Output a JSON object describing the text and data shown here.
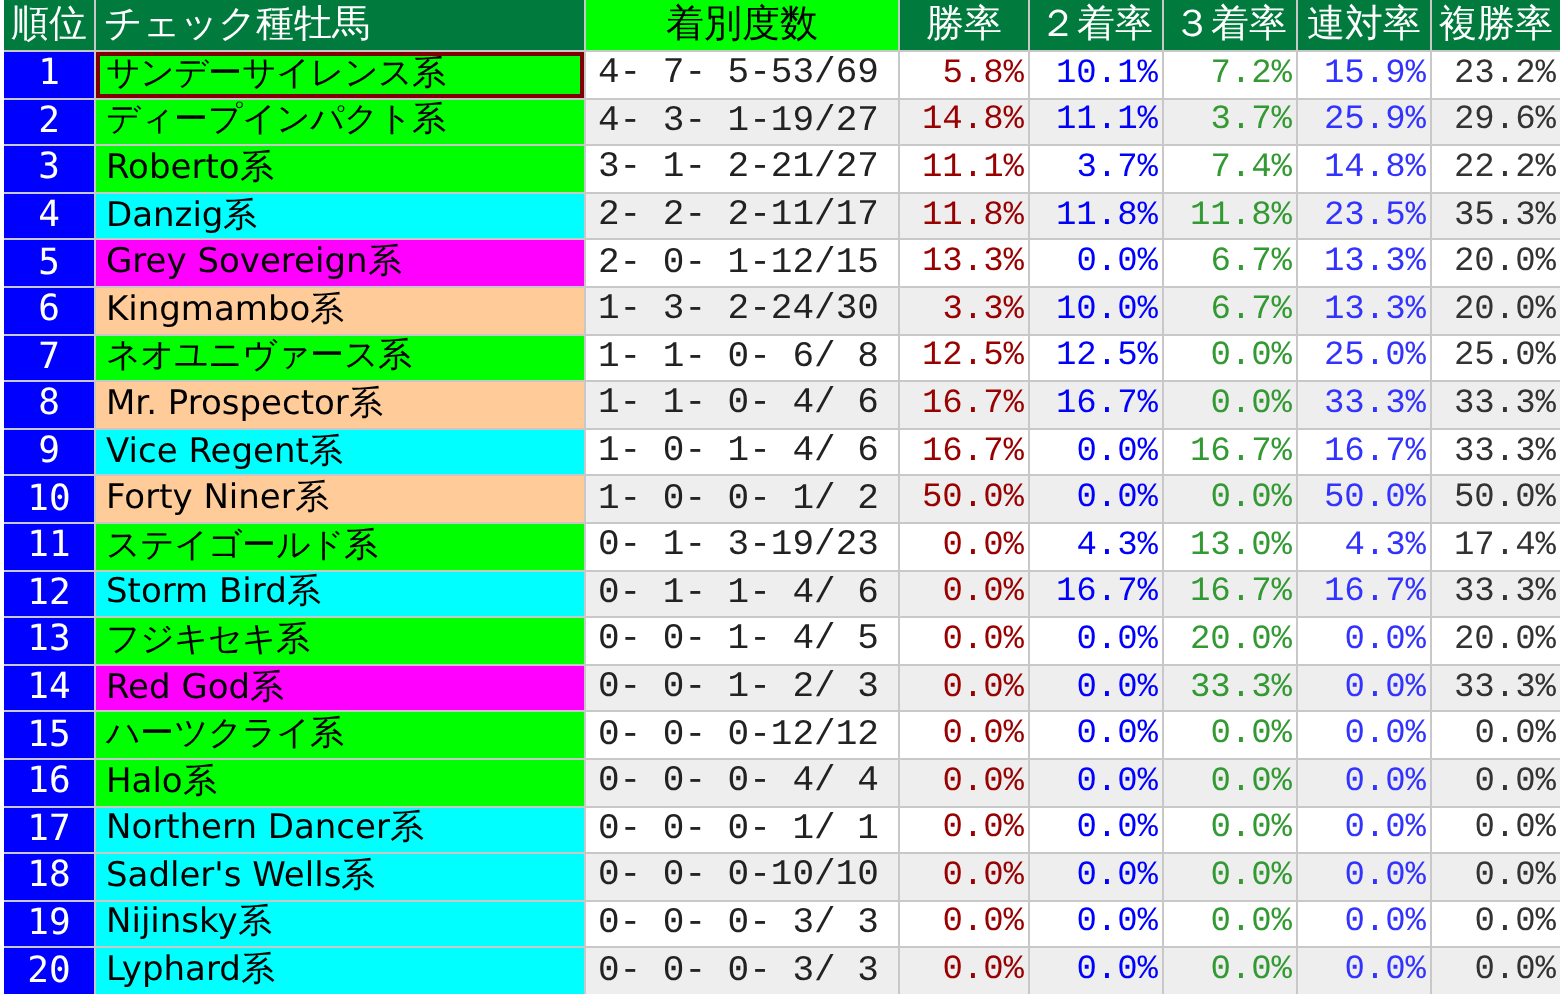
{
  "columns": [
    {
      "label": "順位",
      "highlighted": false
    },
    {
      "label": "チェック種牡馬",
      "highlighted": false
    },
    {
      "label": "着別度数",
      "highlighted": true
    },
    {
      "label": "勝率",
      "highlighted": false
    },
    {
      "label": "２着率",
      "highlighted": false
    },
    {
      "label": "３着率",
      "highlighted": false
    },
    {
      "label": "連対率",
      "highlighted": false
    },
    {
      "label": "複勝率",
      "highlighted": false
    }
  ],
  "rows": [
    {
      "rank": "1",
      "sire": "サンデーサイレンス系",
      "color": "#00ff00",
      "selected": true,
      "record": "4- 7- 5-53/69",
      "rates": [
        "5.8%",
        "10.1%",
        "7.2%",
        "15.9%",
        "23.2%"
      ]
    },
    {
      "rank": "2",
      "sire": "ディープインパクト系",
      "color": "#00ff00",
      "selected": false,
      "record": "4- 3- 1-19/27",
      "rates": [
        "14.8%",
        "11.1%",
        "3.7%",
        "25.9%",
        "29.6%"
      ]
    },
    {
      "rank": "3",
      "sire": "Roberto系",
      "color": "#00ff00",
      "selected": false,
      "record": "3- 1- 2-21/27",
      "rates": [
        "11.1%",
        "3.7%",
        "7.4%",
        "14.8%",
        "22.2%"
      ]
    },
    {
      "rank": "4",
      "sire": "Danzig系",
      "color": "#00ffff",
      "selected": false,
      "record": "2- 2- 2-11/17",
      "rates": [
        "11.8%",
        "11.8%",
        "11.8%",
        "23.5%",
        "35.3%"
      ]
    },
    {
      "rank": "5",
      "sire": "Grey Sovereign系",
      "color": "#ff00ff",
      "selected": false,
      "record": "2- 0- 1-12/15",
      "rates": [
        "13.3%",
        "0.0%",
        "6.7%",
        "13.3%",
        "20.0%"
      ]
    },
    {
      "rank": "6",
      "sire": "Kingmambo系",
      "color": "#ffcc99",
      "selected": false,
      "record": "1- 3- 2-24/30",
      "rates": [
        "3.3%",
        "10.0%",
        "6.7%",
        "13.3%",
        "20.0%"
      ]
    },
    {
      "rank": "7",
      "sire": "ネオユニヴァース系",
      "color": "#00ff00",
      "selected": false,
      "record": "1- 1- 0- 6/ 8",
      "rates": [
        "12.5%",
        "12.5%",
        "0.0%",
        "25.0%",
        "25.0%"
      ]
    },
    {
      "rank": "8",
      "sire": "Mr. Prospector系",
      "color": "#ffcc99",
      "selected": false,
      "record": "1- 1- 0- 4/ 6",
      "rates": [
        "16.7%",
        "16.7%",
        "0.0%",
        "33.3%",
        "33.3%"
      ]
    },
    {
      "rank": "9",
      "sire": "Vice Regent系",
      "color": "#00ffff",
      "selected": false,
      "record": "1- 0- 1- 4/ 6",
      "rates": [
        "16.7%",
        "0.0%",
        "16.7%",
        "16.7%",
        "33.3%"
      ]
    },
    {
      "rank": "10",
      "sire": "Forty Niner系",
      "color": "#ffcc99",
      "selected": false,
      "record": "1- 0- 0- 1/ 2",
      "rates": [
        "50.0%",
        "0.0%",
        "0.0%",
        "50.0%",
        "50.0%"
      ]
    },
    {
      "rank": "11",
      "sire": "ステイゴールド系",
      "color": "#00ff00",
      "selected": false,
      "record": "0- 1- 3-19/23",
      "rates": [
        "0.0%",
        "4.3%",
        "13.0%",
        "4.3%",
        "17.4%"
      ]
    },
    {
      "rank": "12",
      "sire": "Storm Bird系",
      "color": "#00ffff",
      "selected": false,
      "record": "0- 1- 1- 4/ 6",
      "rates": [
        "0.0%",
        "16.7%",
        "16.7%",
        "16.7%",
        "33.3%"
      ]
    },
    {
      "rank": "13",
      "sire": "フジキセキ系",
      "color": "#00ff00",
      "selected": false,
      "record": "0- 0- 1- 4/ 5",
      "rates": [
        "0.0%",
        "0.0%",
        "20.0%",
        "0.0%",
        "20.0%"
      ]
    },
    {
      "rank": "14",
      "sire": "Red God系",
      "color": "#ff00ff",
      "selected": false,
      "record": "0- 0- 1- 2/ 3",
      "rates": [
        "0.0%",
        "0.0%",
        "33.3%",
        "0.0%",
        "33.3%"
      ]
    },
    {
      "rank": "15",
      "sire": "ハーツクライ系",
      "color": "#00ff00",
      "selected": false,
      "record": "0- 0- 0-12/12",
      "rates": [
        "0.0%",
        "0.0%",
        "0.0%",
        "0.0%",
        "0.0%"
      ]
    },
    {
      "rank": "16",
      "sire": "Halo系",
      "color": "#00ff00",
      "selected": false,
      "record": "0- 0- 0- 4/ 4",
      "rates": [
        "0.0%",
        "0.0%",
        "0.0%",
        "0.0%",
        "0.0%"
      ]
    },
    {
      "rank": "17",
      "sire": "Northern Dancer系",
      "color": "#00ffff",
      "selected": false,
      "record": "0- 0- 0- 1/ 1",
      "rates": [
        "0.0%",
        "0.0%",
        "0.0%",
        "0.0%",
        "0.0%"
      ]
    },
    {
      "rank": "18",
      "sire": "Sadler's Wells系",
      "color": "#00ffff",
      "selected": false,
      "record": "0- 0- 0-10/10",
      "rates": [
        "0.0%",
        "0.0%",
        "0.0%",
        "0.0%",
        "0.0%"
      ]
    },
    {
      "rank": "19",
      "sire": "Nijinsky系",
      "color": "#00ffff",
      "selected": false,
      "record": "0- 0- 0- 3/ 3",
      "rates": [
        "0.0%",
        "0.0%",
        "0.0%",
        "0.0%",
        "0.0%"
      ]
    },
    {
      "rank": "20",
      "sire": "Lyphard系",
      "color": "#00ffff",
      "selected": false,
      "record": "0- 0- 0- 3/ 3",
      "rates": [
        "0.0%",
        "0.0%",
        "0.0%",
        "0.0%",
        "0.0%"
      ]
    }
  ]
}
